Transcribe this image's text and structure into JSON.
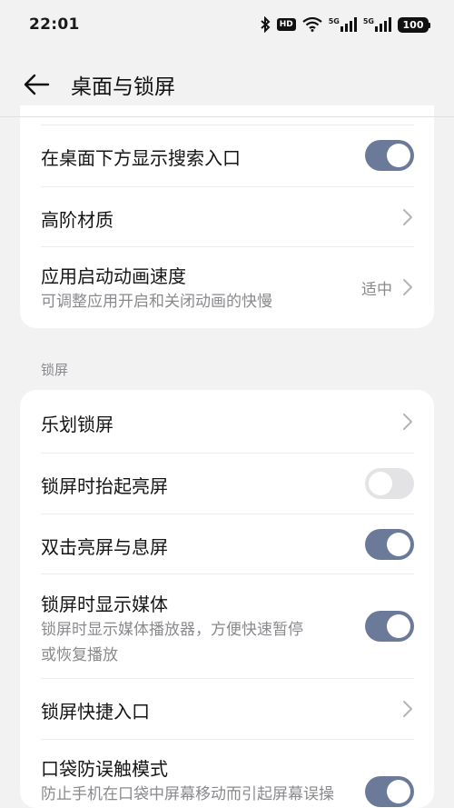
{
  "status_bar": {
    "time": "22:01",
    "hd_label": "HD",
    "signal1_label": "5G",
    "signal2_label": "5G",
    "battery": "100"
  },
  "header": {
    "title": "桌面与锁屏"
  },
  "desktop_section": {
    "items": [
      {
        "title": "在桌面下方显示搜索入口",
        "control": "toggle",
        "on": true
      },
      {
        "title": "高阶材质",
        "control": "chevron"
      },
      {
        "title": "应用启动动画速度",
        "subtitle": "可调整应用开启和关闭动画的快慢",
        "value": "适中",
        "control": "chevron"
      }
    ]
  },
  "lock_section": {
    "label": "锁屏",
    "items": [
      {
        "title": "乐划锁屏",
        "control": "chevron"
      },
      {
        "title": "锁屏时抬起亮屏",
        "control": "toggle",
        "on": false
      },
      {
        "title": "双击亮屏与息屏",
        "control": "toggle",
        "on": true
      },
      {
        "title": "锁屏时显示媒体",
        "subtitle_line1": "锁屏时显示媒体播放器，方便快速暂停",
        "subtitle_line2": "或恢复播放",
        "control": "toggle",
        "on": true
      },
      {
        "title": "锁屏快捷入口",
        "control": "chevron"
      },
      {
        "title": "口袋防误触模式",
        "subtitle": "防止手机在口袋中屏幕移动而引起屏幕误操",
        "control": "toggle",
        "on": true
      }
    ]
  },
  "colors": {
    "toggle_on": "#6b7a98",
    "toggle_off": "#e3e3e6",
    "background": "#f2f2f3",
    "card": "#ffffff"
  }
}
